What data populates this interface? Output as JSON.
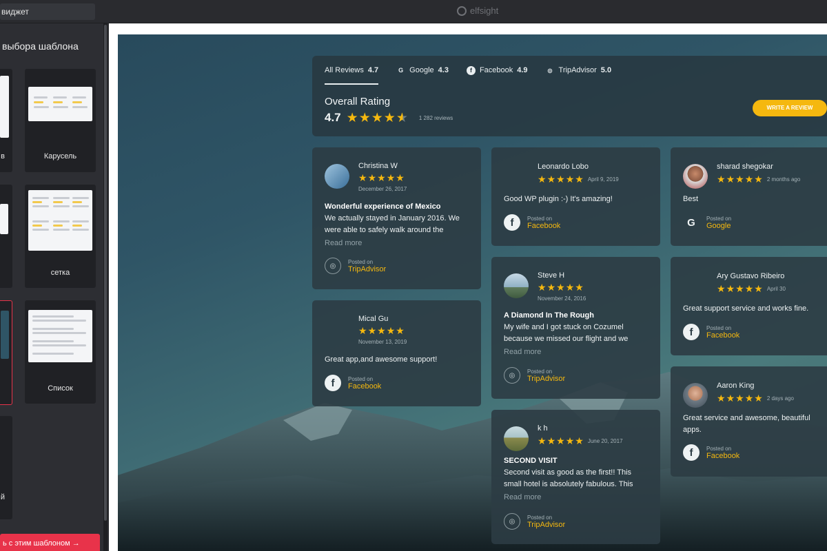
{
  "topbar": {
    "widget_name": "виджет",
    "logo_text": "elfsight"
  },
  "left_panel": {
    "heading": "выбора шаблона",
    "templates": [
      {
        "label": "в"
      },
      {
        "label": "Карусель"
      },
      {
        "label": ""
      },
      {
        "label": "сетка"
      },
      {
        "label": ""
      },
      {
        "label": "Список"
      },
      {
        "label": "й"
      }
    ],
    "use_button": "ь с этим шаблоном  →"
  },
  "header": {
    "tabs": [
      {
        "label": "All Reviews",
        "rating": "4.7",
        "icon": "none"
      },
      {
        "label": "Google",
        "rating": "4.3",
        "icon": "google-icon"
      },
      {
        "label": "Facebook",
        "rating": "4.9",
        "icon": "facebook-icon"
      },
      {
        "label": "TripAdvisor",
        "rating": "5.0",
        "icon": "tripadvisor-icon"
      }
    ],
    "overall_title": "Overall Rating",
    "overall_value": "4.7",
    "overall_stars": 4.7,
    "review_count": "1 282 reviews",
    "write_button": "WRITE A REVIEW"
  },
  "reviews": [
    {
      "name": "Christina W",
      "date": "December 26, 2017",
      "stars": 5,
      "title": "Wonderful experience of Mexico",
      "text": "We actually stayed in January 2016. We were able to safely walk around the",
      "more": "Read more",
      "posted_label": "Posted on",
      "source": "TripAdvisor"
    },
    {
      "name": "Mical Gu",
      "date": "November 13, 2019",
      "stars": 5,
      "title": "",
      "text": "Great app,and awesome support!",
      "more": "",
      "posted_label": "Posted on",
      "source": "Facebook"
    },
    {
      "name": "Leonardo Lobo",
      "date": "April 9, 2019",
      "stars": 5,
      "title": "",
      "text": "Good WP plugin :-) It's amazing!",
      "more": "",
      "posted_label": "Posted on",
      "source": "Facebook"
    },
    {
      "name": "Steve H",
      "date": "November 24, 2016",
      "stars": 5,
      "title": "A Diamond In The Rough",
      "text": "My wife and I got stuck on Cozumel because we missed our flight and we",
      "more": "Read more",
      "posted_label": "Posted on",
      "source": "TripAdvisor"
    },
    {
      "name": "k h",
      "date": "June 20, 2017",
      "stars": 5,
      "title": "SECOND VISIT",
      "text": "Second visit as good as the first!! This small hotel is absolutely fabulous. This",
      "more": "Read more",
      "posted_label": "Posted on",
      "source": "TripAdvisor"
    },
    {
      "name": "sharad shegokar",
      "date": "2 months ago",
      "stars": 5,
      "title": "",
      "text": "Best",
      "more": "",
      "posted_label": "Posted on",
      "source": "Google"
    },
    {
      "name": "Ary Gustavo Ribeiro",
      "date": "April 30",
      "stars": 5,
      "title": "",
      "text": "Great support service and works fine.",
      "more": "",
      "posted_label": "Posted on",
      "source": "Facebook"
    },
    {
      "name": "Aaron King",
      "date": "2 days ago",
      "stars": 5,
      "title": "",
      "text": "Great service and awesome, beautiful apps.",
      "more": "",
      "posted_label": "Posted on",
      "source": "Facebook"
    }
  ],
  "colors": {
    "accent": "#f5b80f",
    "danger": "#e8334a",
    "card": "#2c3c44"
  }
}
